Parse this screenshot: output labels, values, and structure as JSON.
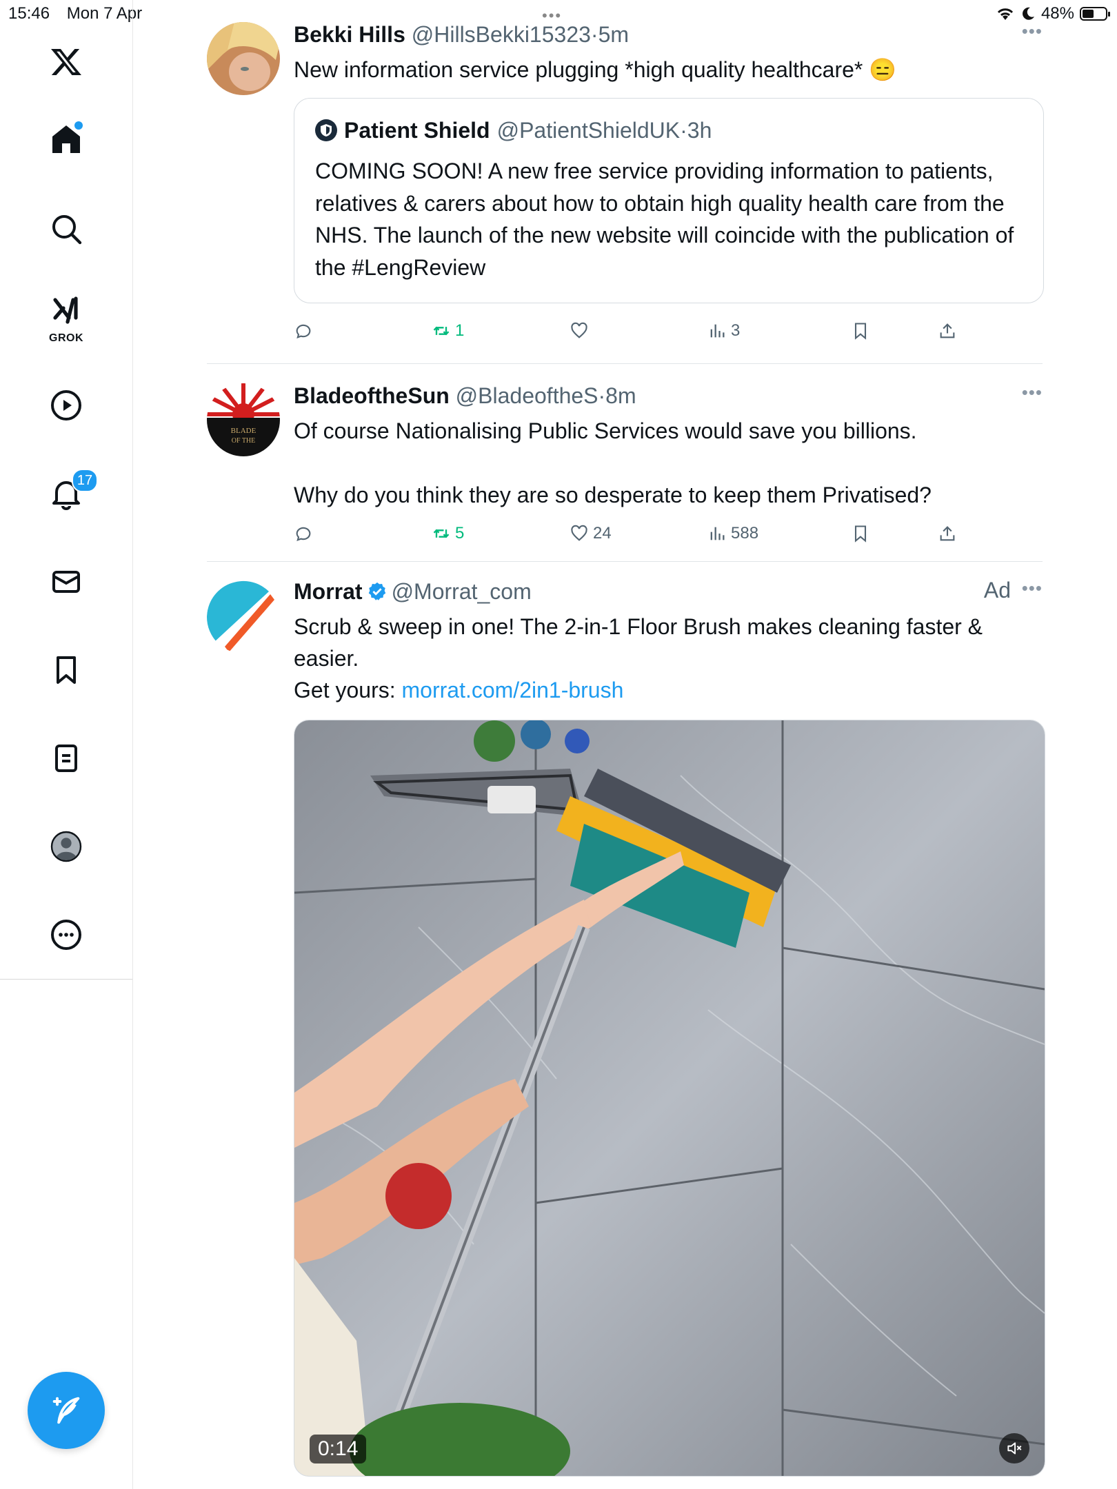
{
  "status_bar": {
    "time": "15:46",
    "date": "Mon 7 Apr",
    "battery": "48%"
  },
  "sidebar": {
    "grok_label": "GROK",
    "notifications_count": "17"
  },
  "tweets": [
    {
      "name": "Bekki Hills",
      "handle": "@HillsBekki15323",
      "dot": "·",
      "time": "5m",
      "text": "New information service plugging *high quality healthcare* 😑",
      "quote": {
        "name": "Patient Shield",
        "handle": "@PatientShieldUK",
        "dot": "·",
        "time": "3h",
        "text": "COMING SOON! A new free service providing information to patients, relatives & carers about how to obtain high quality health care from the NHS. The launch of the new website will coincide with the publication of the #LengReview"
      },
      "stats": {
        "retweets": "1",
        "likes": "",
        "views": "3"
      }
    },
    {
      "name": "BladeoftheSun",
      "handle": "@BladeoftheS",
      "dot": "·",
      "time": "8m",
      "text_line1": "Of course Nationalising Public Services would save you billions.",
      "text_line2": "Why do you think they are so desperate to keep them Privatised?",
      "avatar_text": "BLADE OF THE",
      "stats": {
        "retweets": "5",
        "likes": "24",
        "views": "588"
      }
    },
    {
      "name": "Morrat",
      "handle": "@Morrat_com",
      "ad_label": "Ad",
      "text": "Scrub & sweep in one! The 2-in-1 Floor Brush makes cleaning faster & easier.",
      "cta_prefix": "Get yours: ",
      "link": "morrat.com/2in1-brush",
      "video_time": "0:14"
    }
  ],
  "colors": {
    "accent": "#1d9bf0",
    "retweet": "#00ba7c"
  },
  "icons": [
    "x-logo-icon",
    "home-icon",
    "search-icon",
    "grok-icon",
    "video-icon",
    "bell-icon",
    "mail-icon",
    "bookmark-icon",
    "lists-icon",
    "profile-icon",
    "more-icon",
    "compose-icon",
    "reply-icon",
    "retweet-icon",
    "like-icon",
    "views-icon",
    "share-icon",
    "verified-icon",
    "mute-icon"
  ]
}
